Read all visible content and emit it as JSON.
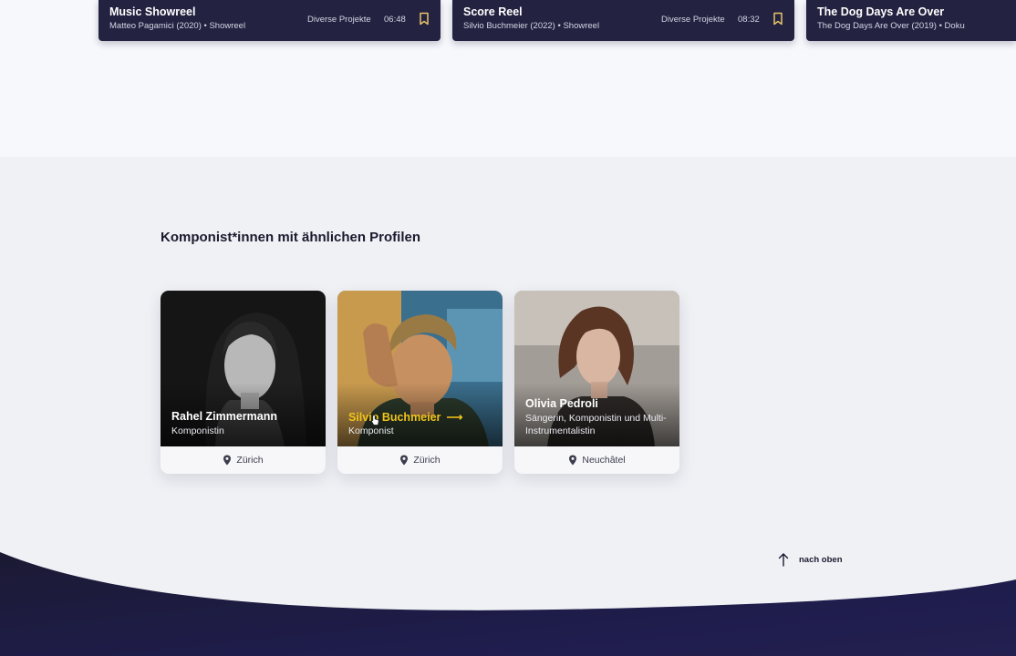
{
  "media_row": [
    {
      "title": "Music Showreel",
      "subtitle": "Matteo Pagamici (2020) • Showreel",
      "category": "Diverse Projekte",
      "duration": "06:48"
    },
    {
      "title": "Score Reel",
      "subtitle": "Silvio Buchmeier (2022) • Showreel",
      "category": "Diverse Projekte",
      "duration": "08:32"
    },
    {
      "title": "The Dog Days Are Over",
      "subtitle": "The Dog Days Are Over (2019) • Doku"
    }
  ],
  "similar": {
    "heading": "Komponist*innen mit ähnlichen Profilen",
    "cards": [
      {
        "name": "Rahel Zimmermann",
        "role": "Komponistin",
        "location": "Zürich"
      },
      {
        "name": "Silvio Buchmeier",
        "role": "Komponist",
        "location": "Zürich"
      },
      {
        "name": "Olivia Pedroli",
        "role": "Sängerin, Komponistin und Multi-Instrumentalistin",
        "location": "Neuchâtel"
      }
    ]
  },
  "back_to_top": {
    "label": "nach oben"
  },
  "icons": {
    "bookmark": "bookmark-icon",
    "location": "location-pin-icon",
    "arrow": "arrow-right-icon",
    "up": "arrow-up-icon"
  },
  "colors": {
    "card_dark": "#232240",
    "accent_hover": "#f0c419",
    "footer": "#1c1a3a",
    "bookmark": "#e9c46a"
  }
}
